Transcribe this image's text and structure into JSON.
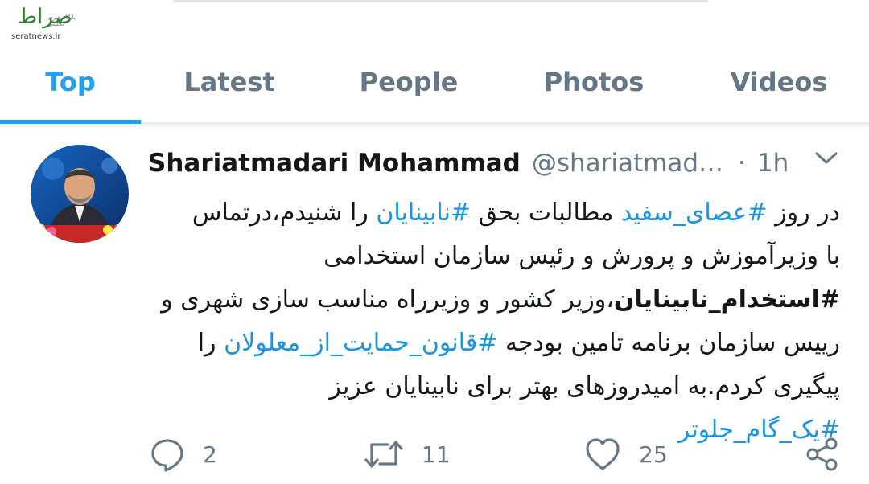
{
  "logo": {
    "mark": "صراط",
    "small": "پایگاه خبری تحلیلی",
    "url": "seratnews.ir"
  },
  "tabs": [
    {
      "label": "Top",
      "active": true
    },
    {
      "label": "Latest",
      "active": false
    },
    {
      "label": "People",
      "active": false
    },
    {
      "label": "Photos",
      "active": false
    },
    {
      "label": "Videos",
      "active": false
    }
  ],
  "tweet": {
    "name": "Shariatmadari Mohammad",
    "handle": "@shariatmad…",
    "separator": "·",
    "time": "1h",
    "lines": {
      "l1_a": "در روز ",
      "l1_h1": "#عصای_سفید",
      "l1_b": " مطالبات بحق ",
      "l1_h2": "#نابینایان",
      "l1_c": " را شنیدم،درتماس",
      "l2": "با وزیرآموزش و پرورش و رئیس سازمان استخدامی",
      "l3_h": "#استخدام_نابینایان",
      "l3_b": "،وزیر کشور و وزیرراه مناسب سازی شهری و",
      "l4_a": "رییس سازمان برنامه تامین بودجه ",
      "l4_h": "#قانون_حمایت_از_معلولان",
      "l4_b": " را",
      "l5": "پیگیری کردم.به امیدروزهای بهتر برای نابینایان عزیز",
      "l6_h": "#یک_گام_جلوتر"
    },
    "actions": {
      "replies": "2",
      "retweets": "11",
      "likes": "25"
    }
  },
  "colors": {
    "accent": "#1da1f2",
    "hashtag": "#1b95e0",
    "secondary": "#657786",
    "text": "#14171a"
  },
  "icons": [
    "chevron-down-icon",
    "reply-icon",
    "retweet-icon",
    "like-icon",
    "share-icon"
  ]
}
